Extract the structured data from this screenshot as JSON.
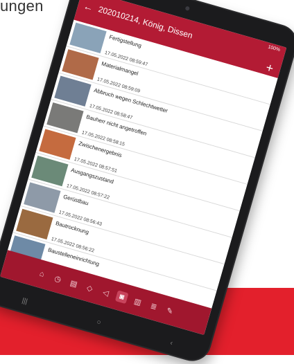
{
  "corner_text": "ungen",
  "statusbar": {
    "text": "100%"
  },
  "header": {
    "title": "202010214, König, Dissen",
    "back_icon": "arrow-left-icon",
    "add_icon": "plus-icon"
  },
  "entries": [
    {
      "label": "Fertigstellung",
      "date": "17.05.2022 08:59:47",
      "thumb_color": "#8aa3b8"
    },
    {
      "label": "Materialmangel",
      "date": "17.05.2022 08:59:09",
      "thumb_color": "#b06a48"
    },
    {
      "label": "Abbruch wegen Schlechtwetter",
      "date": "17.05.2022 08:58:47",
      "thumb_color": "#6f7f94"
    },
    {
      "label": "Bauherr nicht angetroffen",
      "date": "17.05.2022 08:58:15",
      "thumb_color": "#7a7a78"
    },
    {
      "label": "Zwischenergebnis",
      "date": "17.05.2022 08:57:51",
      "thumb_color": "#c56b3f"
    },
    {
      "label": "Ausgangszustand",
      "date": "17.05.2022 08:57:22",
      "thumb_color": "#6b8a78"
    },
    {
      "label": "Gerüstbau",
      "date": "17.05.2022 08:56:43",
      "thumb_color": "#8e9aa8"
    },
    {
      "label": "Bautrocknung",
      "date": "17.05.2022 08:56:22",
      "thumb_color": "#9a6a40"
    },
    {
      "label": "Baustelleneinrichtung",
      "date": "",
      "thumb_color": "#6e8aa6"
    }
  ],
  "bottom_nav": [
    {
      "icon": "home-icon",
      "glyph": "⌂",
      "active": false
    },
    {
      "icon": "timer-icon",
      "glyph": "◷",
      "active": false
    },
    {
      "icon": "clipboard-icon",
      "glyph": "▤",
      "active": false
    },
    {
      "icon": "cube-icon",
      "glyph": "◇",
      "active": false
    },
    {
      "icon": "megaphone-icon",
      "glyph": "◁",
      "active": false
    },
    {
      "icon": "camera-icon",
      "glyph": "◙",
      "active": true
    },
    {
      "icon": "document-icon",
      "glyph": "▥",
      "active": false
    },
    {
      "icon": "notes-icon",
      "glyph": "≣",
      "active": false
    },
    {
      "icon": "pen-icon",
      "glyph": "✎",
      "active": false
    }
  ],
  "system_nav": [
    "|||",
    "○",
    "‹"
  ]
}
